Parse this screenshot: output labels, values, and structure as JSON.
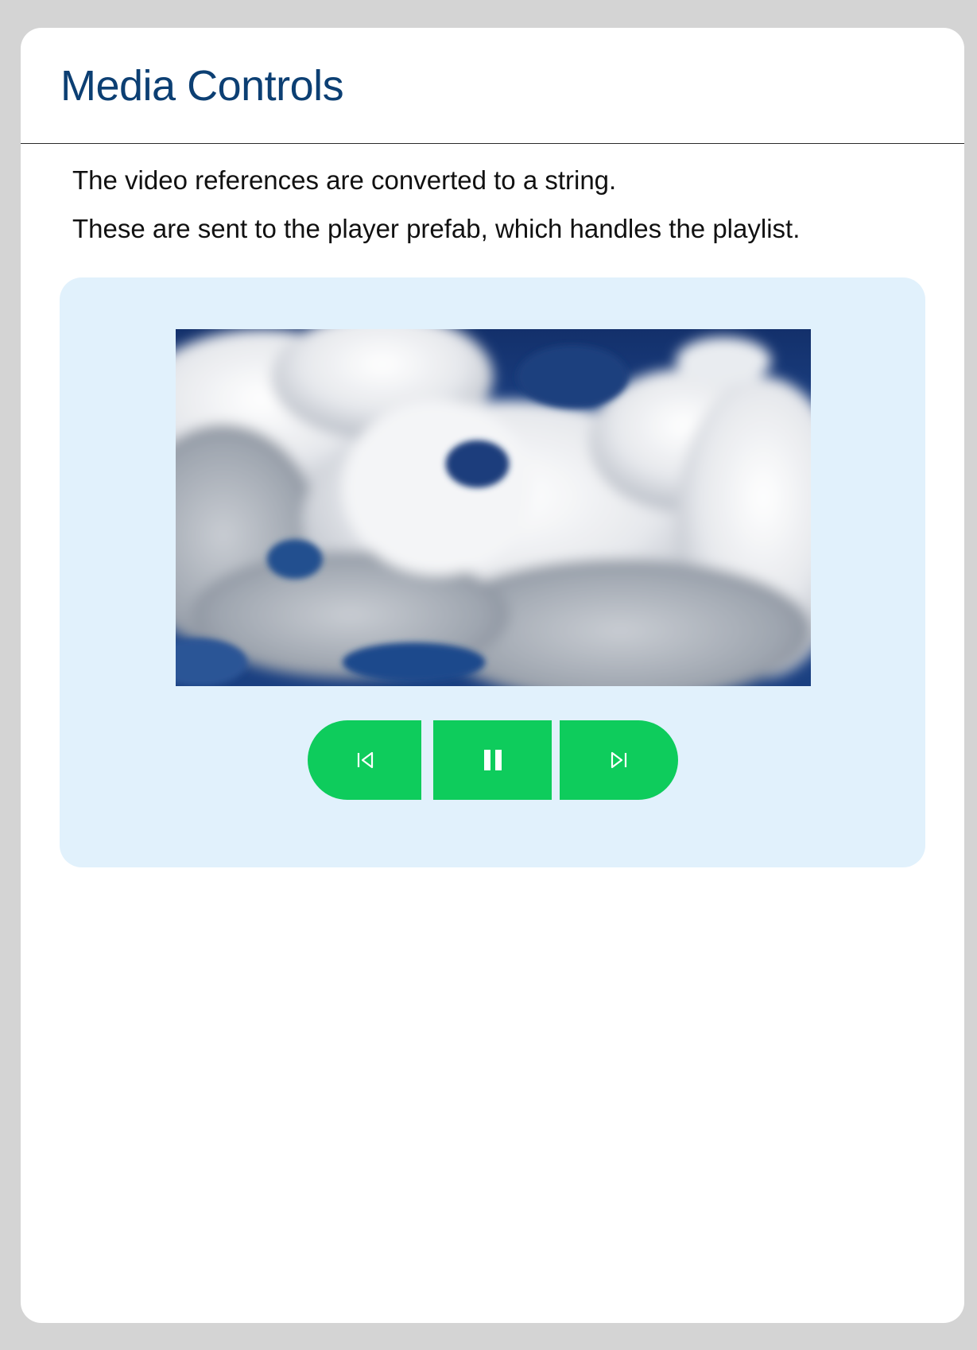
{
  "header": {
    "title": "Media Controls"
  },
  "content": {
    "lines": [
      "The video references are converted to a string.",
      "These are sent to the player prefab, which handles the playlist."
    ]
  },
  "player": {
    "video_subject": "cloudy-sky",
    "controls": [
      {
        "name": "previous",
        "icon": "skip-previous-icon"
      },
      {
        "name": "pause",
        "icon": "pause-icon"
      },
      {
        "name": "next",
        "icon": "skip-next-icon"
      }
    ]
  },
  "colors": {
    "title": "#0c3f73",
    "panel_bg": "#e1f1fc",
    "button_bg": "#0ecc5c",
    "page_bg": "#d4d4d4",
    "card_bg": "#ffffff"
  }
}
